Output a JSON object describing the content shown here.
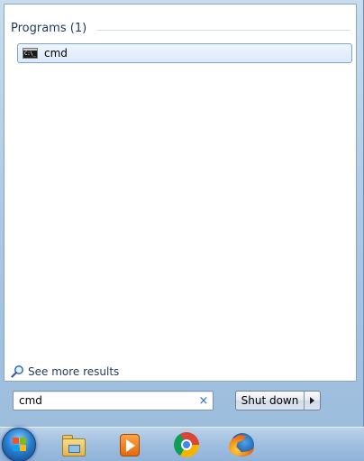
{
  "results": {
    "group_header": "Programs (1)",
    "items": [
      {
        "label": "cmd",
        "icon": "command-prompt-icon",
        "icon_text": "C:\\_"
      }
    ],
    "see_more_label": "See more results"
  },
  "search": {
    "value": "cmd",
    "clear_glyph": "×"
  },
  "shutdown": {
    "label": "Shut down"
  },
  "taskbar": {
    "items": [
      {
        "name": "start-button",
        "icon": "windows-orb-icon"
      },
      {
        "name": "windows-explorer",
        "icon": "folder-icon"
      },
      {
        "name": "media-player",
        "icon": "media-player-icon"
      },
      {
        "name": "google-chrome",
        "icon": "chrome-icon"
      },
      {
        "name": "mozilla-firefox",
        "icon": "firefox-icon"
      }
    ]
  },
  "colors": {
    "accent_text": "#1e395b",
    "selection_border": "#7da2ce",
    "clear_icon": "#2a6cc6"
  }
}
